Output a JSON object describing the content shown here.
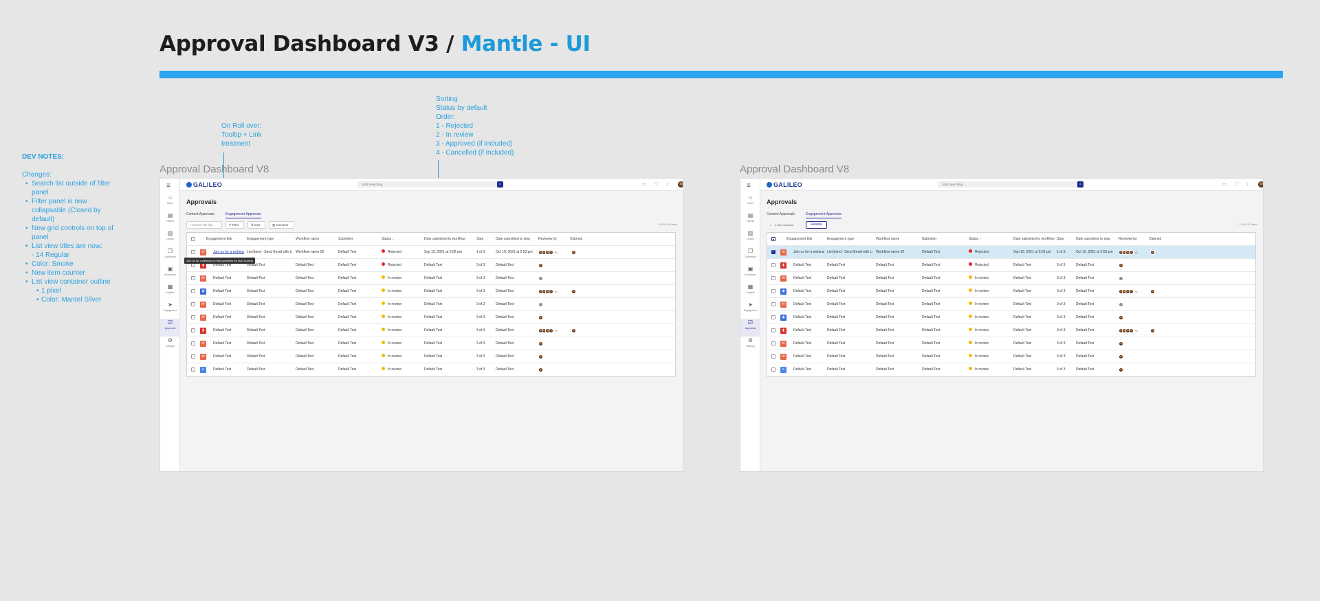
{
  "header": {
    "title": "Approval Dashboard V3 / ",
    "title_accent": "Mantle - UI"
  },
  "dev_notes": {
    "title": "DEV NOTES:",
    "changes_label": "Changes:",
    "items": [
      {
        "text": "Search list outside of filter panel",
        "level": 1
      },
      {
        "text": "Filter panel is now collapsable (Closed by default)",
        "level": 1
      },
      {
        "text": "New grid controls on top of panel",
        "level": 1
      },
      {
        "text": "List view titles are now:",
        "level": 1
      },
      {
        "text": "- 14 Regular",
        "level": 0
      },
      {
        "text": "Color: Smoke",
        "level": 1
      },
      {
        "text": "New item counter",
        "level": 1
      },
      {
        "text": "List view container outline",
        "level": 1
      },
      {
        "text": "1 pixel",
        "level": 2
      },
      {
        "text": "Color: Mantel Silver",
        "level": 2
      }
    ]
  },
  "annotations": {
    "rollover": [
      "On Roll over:",
      "Tooltip + Link",
      "treatment"
    ],
    "sorting": [
      "Sorting",
      "Status by default",
      "Order:",
      "1 - Rejected",
      "2 - In review",
      "3 - Approved (if included)",
      "4 - Cancelled (if included)"
    ]
  },
  "colors": {
    "accent": "#1d9ad9",
    "bar": "#2aa4ec",
    "brand": "#2d3093",
    "rejected": "#e5252a",
    "in_review": "#f5b800"
  },
  "app": {
    "logo": "GALILEO",
    "search_placeholder": "Start searching...",
    "page_title": "Approvals",
    "tabs": [
      "Content Approvals",
      "Engagement Approvals"
    ],
    "sidebar": [
      {
        "label": "Home",
        "icon": "home-icon"
      },
      {
        "label": "Planner",
        "icon": "planner-icon"
      },
      {
        "label": "Library",
        "icon": "library-icon"
      },
      {
        "label": "Collections",
        "icon": "collections-icon"
      },
      {
        "label": "Workspace",
        "icon": "workspace-icon"
      },
      {
        "label": "Insights",
        "icon": "insights-icon"
      },
      {
        "label": "Engagement",
        "icon": "engagement-icon"
      },
      {
        "label": "Approvals",
        "icon": "approvals-icon"
      },
      {
        "label": "Settings",
        "icon": "settings-icon"
      }
    ],
    "toolbar": {
      "search_placeholder": "Search the list...",
      "filter": "Filter",
      "sort": "Sort",
      "columns": "Columns",
      "selected": "1 Item selected",
      "review": "Review"
    },
    "columns": [
      "Engagement title",
      "Engagement type",
      "Workflow name",
      "Submitter",
      "Status",
      "Date submitted to workflow",
      "Step",
      "Date submitted to step",
      "Reviewer(s)",
      "Claimed"
    ],
    "default_text": "Default Text",
    "status_labels": {
      "rejected": "Rejected",
      "in_review": "In review"
    }
  },
  "frames": [
    {
      "label": "Approval Dashboard V8",
      "count": "1-90 of 114 items",
      "tooltip": "Join us for a webinar on best practices for lead scoring",
      "rows": [
        {
          "title": "Join us for a webinar...",
          "type": "LiveSend - Send Email with Link",
          "workflow": "Workflow name 02",
          "submitter": "Default Text",
          "status": "Rejected",
          "date_wf": "Sep 15, 2021 at 5:02 pm",
          "step": "1 of 3",
          "date_step": "Oct 10, 2021 at 2:53 pm",
          "reviewers": 4,
          "more": "+5",
          "claimed": true,
          "icon": "email",
          "selected": false
        },
        {
          "title": "Default Text",
          "type": "Default Text",
          "workflow": "Default Text",
          "submitter": "Default Text",
          "status": "Rejected",
          "date_wf": "Default Text",
          "step": "3 of 3",
          "date_step": "Default Text",
          "reviewers": 1,
          "more": "",
          "claimed": false,
          "icon": "pdf",
          "selected": false
        },
        {
          "title": "Default Text",
          "type": "Default Text",
          "workflow": "Default Text",
          "submitter": "Default Text",
          "status": "In review",
          "date_wf": "Default Text",
          "step": "3 of 3",
          "date_step": "Default Text",
          "reviewers": 1,
          "more": "",
          "claimed": false,
          "icon": "email",
          "gray": true,
          "selected": false
        },
        {
          "title": "Default Text",
          "type": "Default Text",
          "workflow": "Default Text",
          "submitter": "Default Text",
          "status": "In review",
          "date_wf": "Default Text",
          "step": "3 of 3",
          "date_step": "Default Text",
          "reviewers": 4,
          "more": "+5",
          "claimed": true,
          "icon": "web",
          "selected": false
        },
        {
          "title": "Default Text",
          "type": "Default Text",
          "workflow": "Default Text",
          "submitter": "Default Text",
          "status": "In review",
          "date_wf": "Default Text",
          "step": "3 of 3",
          "date_step": "Default Text",
          "reviewers": 1,
          "more": "",
          "claimed": false,
          "icon": "email",
          "gray": true,
          "selected": false
        },
        {
          "title": "Default Text",
          "type": "Default Text",
          "workflow": "Default Text",
          "submitter": "Default Text",
          "status": "In review",
          "date_wf": "Default Text",
          "step": "3 of 3",
          "date_step": "Default Text",
          "reviewers": 1,
          "more": "",
          "claimed": false,
          "icon": "email",
          "selected": false
        },
        {
          "title": "Default Text",
          "type": "Default Text",
          "workflow": "Default Text",
          "submitter": "Default Text",
          "status": "In review",
          "date_wf": "Default Text",
          "step": "3 of 3",
          "date_step": "Default Text",
          "reviewers": 4,
          "more": "+5",
          "claimed": true,
          "icon": "pdf",
          "selected": false
        },
        {
          "title": "Default Text",
          "type": "Default Text",
          "workflow": "Default Text",
          "submitter": "Default Text",
          "status": "In review",
          "date_wf": "Default Text",
          "step": "3 of 3",
          "date_step": "Default Text",
          "reviewers": 1,
          "more": "",
          "claimed": false,
          "icon": "email",
          "selected": false
        },
        {
          "title": "Default Text",
          "type": "Default Text",
          "workflow": "Default Text",
          "submitter": "Default Text",
          "status": "In review",
          "date_wf": "Default Text",
          "step": "3 of 3",
          "date_step": "Default Text",
          "reviewers": 1,
          "more": "",
          "claimed": false,
          "icon": "email",
          "selected": false
        },
        {
          "title": "Default Text",
          "type": "Default Text",
          "workflow": "Default Text",
          "submitter": "Default Text",
          "status": "In review",
          "date_wf": "Default Text",
          "step": "3 of 3",
          "date_step": "Default Text",
          "reviewers": 1,
          "more": "",
          "claimed": false,
          "icon": "doc",
          "selected": false
        }
      ]
    },
    {
      "label": "Approval Dashboard V8",
      "count": "1-90 of 114 items",
      "rows": [
        {
          "title": "Join us for a webinar...",
          "type": "LiveSend - Send Email with Link",
          "workflow": "Workflow name 02",
          "submitter": "Default Text",
          "status": "Rejected",
          "date_wf": "Sep 15, 2021 at 5:02 pm",
          "step": "1 of 3",
          "date_step": "Oct 10, 2021 at 2:53 pm",
          "reviewers": 4,
          "more": "+5",
          "claimed": true,
          "icon": "email",
          "selected": true
        },
        {
          "title": "Default Text",
          "type": "Default Text",
          "workflow": "Default Text",
          "submitter": "Default Text",
          "status": "Rejected",
          "date_wf": "Default Text",
          "step": "3 of 3",
          "date_step": "Default Text",
          "reviewers": 1,
          "more": "",
          "claimed": false,
          "icon": "pdf",
          "selected": false
        },
        {
          "title": "Default Text",
          "type": "Default Text",
          "workflow": "Default Text",
          "submitter": "Default Text",
          "status": "In review",
          "date_wf": "Default Text",
          "step": "3 of 3",
          "date_step": "Default Text",
          "reviewers": 1,
          "more": "",
          "claimed": false,
          "icon": "email",
          "gray": true,
          "selected": false
        },
        {
          "title": "Default Text",
          "type": "Default Text",
          "workflow": "Default Text",
          "submitter": "Default Text",
          "status": "In review",
          "date_wf": "Default Text",
          "step": "3 of 3",
          "date_step": "Default Text",
          "reviewers": 4,
          "more": "+5",
          "claimed": true,
          "icon": "web",
          "selected": false
        },
        {
          "title": "Default Text",
          "type": "Default Text",
          "workflow": "Default Text",
          "submitter": "Default Text",
          "status": "In review",
          "date_wf": "Default Text",
          "step": "3 of 3",
          "date_step": "Default Text",
          "reviewers": 1,
          "more": "",
          "claimed": false,
          "icon": "email",
          "gray": true,
          "selected": false
        },
        {
          "title": "Default Text",
          "type": "Default Text",
          "workflow": "Default Text",
          "submitter": "Default Text",
          "status": "In review",
          "date_wf": "Default Text",
          "step": "3 of 3",
          "date_step": "Default Text",
          "reviewers": 1,
          "more": "",
          "claimed": false,
          "icon": "web",
          "selected": false
        },
        {
          "title": "Default Text",
          "type": "Default Text",
          "workflow": "Default Text",
          "submitter": "Default Text",
          "status": "In review",
          "date_wf": "Default Text",
          "step": "3 of 3",
          "date_step": "Default Text",
          "reviewers": 4,
          "more": "+5",
          "claimed": true,
          "icon": "pdf",
          "selected": false
        },
        {
          "title": "Default Text",
          "type": "Default Text",
          "workflow": "Default Text",
          "submitter": "Default Text",
          "status": "In review",
          "date_wf": "Default Text",
          "step": "3 of 3",
          "date_step": "Default Text",
          "reviewers": 1,
          "more": "",
          "claimed": false,
          "icon": "email",
          "selected": false
        },
        {
          "title": "Default Text",
          "type": "Default Text",
          "workflow": "Default Text",
          "submitter": "Default Text",
          "status": "In review",
          "date_wf": "Default Text",
          "step": "3 of 3",
          "date_step": "Default Text",
          "reviewers": 1,
          "more": "",
          "claimed": false,
          "icon": "email",
          "selected": false
        },
        {
          "title": "Default Text",
          "type": "Default Text",
          "workflow": "Default Text",
          "submitter": "Default Text",
          "status": "In review",
          "date_wf": "Default Text",
          "step": "3 of 3",
          "date_step": "Default Text",
          "reviewers": 1,
          "more": "",
          "claimed": false,
          "icon": "doc",
          "selected": false
        }
      ]
    }
  ]
}
